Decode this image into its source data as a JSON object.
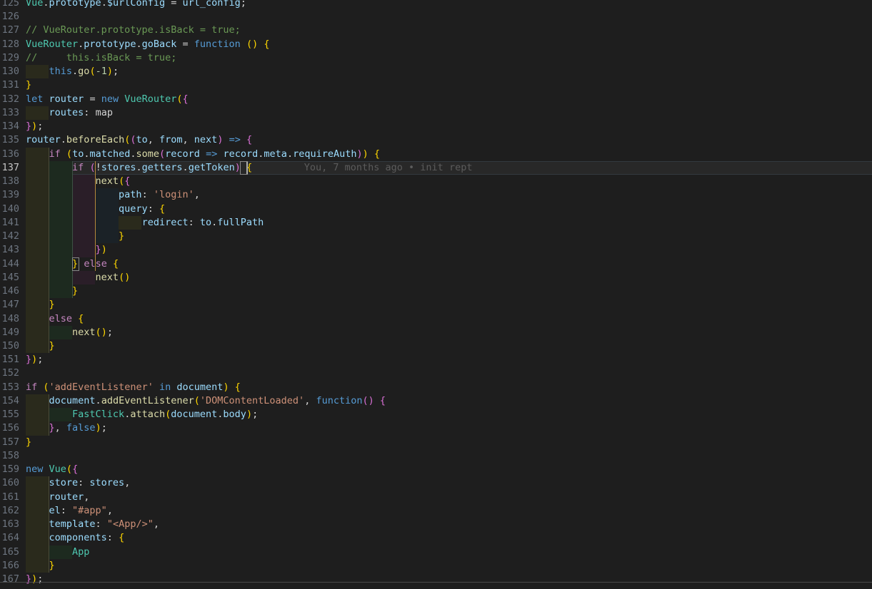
{
  "editor": {
    "name": "code-editor",
    "language": "javascript",
    "theme": "Dark+ (default dark)",
    "background": "#1e1e1e",
    "active_line_number": 137,
    "first_visible_line": 125,
    "last_visible_line": 167,
    "line_height_px": 19.24,
    "font_size_px": 13.5
  },
  "colors": {
    "background": "#1e1e1e",
    "foreground": "#d4d4d4",
    "line_number": "#6e7681",
    "line_number_active": "#c6c6c6",
    "active_line_bg": "#282828",
    "active_line_border": "#333a3f",
    "comment": "#6a9955",
    "keyword": "#c586c0",
    "keyword_blue": "#569cd6",
    "type": "#4ec9b0",
    "variable": "#9cdcfe",
    "function": "#dcdcaa",
    "string": "#ce9178",
    "number": "#b5cea8",
    "bracket_1": "#ffd700",
    "bracket_2": "#da70d6",
    "bracket_3": "#179fff",
    "indent_1": "#2a2a1c",
    "indent_2": "#1d2a1f",
    "indent_3": "#2a1e28",
    "indent_4": "#1b2227",
    "scope_line": "#b5893a",
    "blame_text": "#5c5c5c",
    "cursor": "#aeafad",
    "separator": "#4a4a4a"
  },
  "blame": {
    "name": "git-blame-annotation",
    "line": 137,
    "text": "You, 7 months ago • init rept",
    "author": "You",
    "when": "7 months ago",
    "message": "init rept"
  },
  "lines": [
    {
      "n": 125,
      "indent": 0,
      "tokens": [
        {
          "t": "Vue",
          "c": "c-type"
        },
        {
          "t": ".",
          "c": "c-op"
        },
        {
          "t": "prototype",
          "c": "c-var"
        },
        {
          "t": ".",
          "c": "c-op"
        },
        {
          "t": "$urlConfig",
          "c": "c-var"
        },
        {
          "t": " = ",
          "c": "c-op"
        },
        {
          "t": "url_config",
          "c": "c-var"
        },
        {
          "t": ";",
          "c": "c-op"
        }
      ]
    },
    {
      "n": 126,
      "indent": 0,
      "tokens": []
    },
    {
      "n": 127,
      "indent": 0,
      "tokens": [
        {
          "t": "// VueRouter.prototype.isBack = true;",
          "c": "c-com"
        }
      ]
    },
    {
      "n": 128,
      "indent": 0,
      "tokens": [
        {
          "t": "VueRouter",
          "c": "c-type"
        },
        {
          "t": ".",
          "c": "c-op"
        },
        {
          "t": "prototype",
          "c": "c-var"
        },
        {
          "t": ".",
          "c": "c-op"
        },
        {
          "t": "goBack",
          "c": "c-var"
        },
        {
          "t": " = ",
          "c": "c-op"
        },
        {
          "t": "function",
          "c": "c-kw2"
        },
        {
          "t": " ",
          "c": "c-op"
        },
        {
          "t": "(",
          "c": "c-p1"
        },
        {
          "t": ")",
          "c": "c-p1"
        },
        {
          "t": " ",
          "c": "c-op"
        },
        {
          "t": "{",
          "c": "c-p1"
        }
      ]
    },
    {
      "n": 129,
      "indent": 0,
      "tokens": [
        {
          "t": "//     this.isBack = true;",
          "c": "c-com"
        }
      ]
    },
    {
      "n": 130,
      "indent": 1,
      "tokens": [
        {
          "t": "this",
          "c": "c-kw2"
        },
        {
          "t": ".",
          "c": "c-op"
        },
        {
          "t": "go",
          "c": "c-fn"
        },
        {
          "t": "(",
          "c": "c-p1"
        },
        {
          "t": "-1",
          "c": "c-num"
        },
        {
          "t": ")",
          "c": "c-p1"
        },
        {
          "t": ";",
          "c": "c-op"
        }
      ]
    },
    {
      "n": 131,
      "indent": 0,
      "tokens": [
        {
          "t": "}",
          "c": "c-p1"
        }
      ]
    },
    {
      "n": 132,
      "indent": 0,
      "tokens": [
        {
          "t": "let",
          "c": "c-kw2"
        },
        {
          "t": " ",
          "c": "c-op"
        },
        {
          "t": "router",
          "c": "c-var"
        },
        {
          "t": " = ",
          "c": "c-op"
        },
        {
          "t": "new",
          "c": "c-kw2"
        },
        {
          "t": " ",
          "c": "c-op"
        },
        {
          "t": "VueRouter",
          "c": "c-type"
        },
        {
          "t": "(",
          "c": "c-p1"
        },
        {
          "t": "{",
          "c": "c-p2"
        }
      ]
    },
    {
      "n": 133,
      "indent": 1,
      "tokens": [
        {
          "t": "routes",
          "c": "c-var"
        },
        {
          "t": ": ",
          "c": "c-op"
        },
        {
          "t": "map",
          "c": "c-def"
        }
      ]
    },
    {
      "n": 134,
      "indent": 0,
      "tokens": [
        {
          "t": "}",
          "c": "c-p2"
        },
        {
          "t": ")",
          "c": "c-p1"
        },
        {
          "t": ";",
          "c": "c-op"
        }
      ]
    },
    {
      "n": 135,
      "indent": 0,
      "tokens": [
        {
          "t": "router",
          "c": "c-var"
        },
        {
          "t": ".",
          "c": "c-op"
        },
        {
          "t": "beforeEach",
          "c": "c-fn"
        },
        {
          "t": "(",
          "c": "c-p1"
        },
        {
          "t": "(",
          "c": "c-p2"
        },
        {
          "t": "to",
          "c": "c-var"
        },
        {
          "t": ", ",
          "c": "c-op"
        },
        {
          "t": "from",
          "c": "c-var"
        },
        {
          "t": ", ",
          "c": "c-op"
        },
        {
          "t": "next",
          "c": "c-var"
        },
        {
          "t": ")",
          "c": "c-p2"
        },
        {
          "t": " ",
          "c": "c-op"
        },
        {
          "t": "=>",
          "c": "c-kw2"
        },
        {
          "t": " ",
          "c": "c-op"
        },
        {
          "t": "{",
          "c": "c-p2"
        }
      ]
    },
    {
      "n": 136,
      "indent": 1,
      "tokens": [
        {
          "t": "if",
          "c": "c-kw"
        },
        {
          "t": " ",
          "c": "c-op"
        },
        {
          "t": "(",
          "c": "c-p1"
        },
        {
          "t": "to",
          "c": "c-var"
        },
        {
          "t": ".",
          "c": "c-op"
        },
        {
          "t": "matched",
          "c": "c-var"
        },
        {
          "t": ".",
          "c": "c-op"
        },
        {
          "t": "some",
          "c": "c-fn"
        },
        {
          "t": "(",
          "c": "c-p2"
        },
        {
          "t": "record",
          "c": "c-var"
        },
        {
          "t": " ",
          "c": "c-op"
        },
        {
          "t": "=>",
          "c": "c-kw2"
        },
        {
          "t": " ",
          "c": "c-op"
        },
        {
          "t": "record",
          "c": "c-var"
        },
        {
          "t": ".",
          "c": "c-op"
        },
        {
          "t": "meta",
          "c": "c-var"
        },
        {
          "t": ".",
          "c": "c-op"
        },
        {
          "t": "requireAuth",
          "c": "c-var"
        },
        {
          "t": ")",
          "c": "c-p2"
        },
        {
          "t": ")",
          "c": "c-p1"
        },
        {
          "t": " ",
          "c": "c-op"
        },
        {
          "t": "{",
          "c": "c-p1"
        }
      ]
    },
    {
      "n": 137,
      "indent": 2,
      "active": true,
      "tokens": [
        {
          "t": "if",
          "c": "c-kw"
        },
        {
          "t": " ",
          "c": "c-op"
        },
        {
          "t": "(",
          "c": "c-p2"
        },
        {
          "t": "!",
          "c": "c-op"
        },
        {
          "t": "stores",
          "c": "c-var"
        },
        {
          "t": ".",
          "c": "c-op"
        },
        {
          "t": "getters",
          "c": "c-var"
        },
        {
          "t": ".",
          "c": "c-op"
        },
        {
          "t": "getToken",
          "c": "c-var"
        },
        {
          "t": ")",
          "c": "c-p2"
        },
        {
          "t": " ",
          "c": "c-op"
        },
        {
          "t": "{",
          "c": "c-p1"
        }
      ]
    },
    {
      "n": 138,
      "indent": 3,
      "tokens": [
        {
          "t": "next",
          "c": "c-fn"
        },
        {
          "t": "(",
          "c": "c-p1"
        },
        {
          "t": "{",
          "c": "c-p2"
        }
      ]
    },
    {
      "n": 139,
      "indent": 4,
      "tokens": [
        {
          "t": "path",
          "c": "c-var"
        },
        {
          "t": ": ",
          "c": "c-op"
        },
        {
          "t": "'login'",
          "c": "c-str"
        },
        {
          "t": ",",
          "c": "c-op"
        }
      ]
    },
    {
      "n": 140,
      "indent": 4,
      "tokens": [
        {
          "t": "query",
          "c": "c-var"
        },
        {
          "t": ": ",
          "c": "c-op"
        },
        {
          "t": "{",
          "c": "c-p1"
        }
      ]
    },
    {
      "n": 141,
      "indent": 5,
      "tokens": [
        {
          "t": "redirect",
          "c": "c-var"
        },
        {
          "t": ": ",
          "c": "c-op"
        },
        {
          "t": "to",
          "c": "c-var"
        },
        {
          "t": ".",
          "c": "c-op"
        },
        {
          "t": "fullPath",
          "c": "c-var"
        }
      ]
    },
    {
      "n": 142,
      "indent": 4,
      "tokens": [
        {
          "t": "}",
          "c": "c-p1"
        }
      ]
    },
    {
      "n": 143,
      "indent": 3,
      "tokens": [
        {
          "t": "}",
          "c": "c-p2"
        },
        {
          "t": ")",
          "c": "c-p1"
        }
      ]
    },
    {
      "n": 144,
      "indent": 2,
      "tokens": [
        {
          "t": "}",
          "c": "c-p1"
        },
        {
          "t": " ",
          "c": "c-op"
        },
        {
          "t": "else",
          "c": "c-kw"
        },
        {
          "t": " ",
          "c": "c-op"
        },
        {
          "t": "{",
          "c": "c-p1"
        }
      ]
    },
    {
      "n": 145,
      "indent": 3,
      "tokens": [
        {
          "t": "next",
          "c": "c-fn"
        },
        {
          "t": "(",
          "c": "c-p1"
        },
        {
          "t": ")",
          "c": "c-p1"
        }
      ]
    },
    {
      "n": 146,
      "indent": 2,
      "tokens": [
        {
          "t": "}",
          "c": "c-p1"
        }
      ]
    },
    {
      "n": 147,
      "indent": 1,
      "tokens": [
        {
          "t": "}",
          "c": "c-p1"
        }
      ]
    },
    {
      "n": 148,
      "indent": 1,
      "tokens": [
        {
          "t": "else",
          "c": "c-kw"
        },
        {
          "t": " ",
          "c": "c-op"
        },
        {
          "t": "{",
          "c": "c-p1"
        }
      ]
    },
    {
      "n": 149,
      "indent": 2,
      "tokens": [
        {
          "t": "next",
          "c": "c-fn"
        },
        {
          "t": "(",
          "c": "c-p1"
        },
        {
          "t": ")",
          "c": "c-p1"
        },
        {
          "t": ";",
          "c": "c-op"
        }
      ]
    },
    {
      "n": 150,
      "indent": 1,
      "tokens": [
        {
          "t": "}",
          "c": "c-p1"
        }
      ]
    },
    {
      "n": 151,
      "indent": 0,
      "tokens": [
        {
          "t": "}",
          "c": "c-p2"
        },
        {
          "t": ")",
          "c": "c-p1"
        },
        {
          "t": ";",
          "c": "c-op"
        }
      ]
    },
    {
      "n": 152,
      "indent": 0,
      "tokens": []
    },
    {
      "n": 153,
      "indent": 0,
      "tokens": [
        {
          "t": "if",
          "c": "c-kw"
        },
        {
          "t": " ",
          "c": "c-op"
        },
        {
          "t": "(",
          "c": "c-p1"
        },
        {
          "t": "'addEventListener'",
          "c": "c-str"
        },
        {
          "t": " ",
          "c": "c-op"
        },
        {
          "t": "in",
          "c": "c-kw2"
        },
        {
          "t": " ",
          "c": "c-op"
        },
        {
          "t": "document",
          "c": "c-var"
        },
        {
          "t": ")",
          "c": "c-p1"
        },
        {
          "t": " ",
          "c": "c-op"
        },
        {
          "t": "{",
          "c": "c-p1"
        }
      ]
    },
    {
      "n": 154,
      "indent": 1,
      "tokens": [
        {
          "t": "document",
          "c": "c-var"
        },
        {
          "t": ".",
          "c": "c-op"
        },
        {
          "t": "addEventListener",
          "c": "c-fn"
        },
        {
          "t": "(",
          "c": "c-p1"
        },
        {
          "t": "'DOMContentLoaded'",
          "c": "c-str"
        },
        {
          "t": ", ",
          "c": "c-op"
        },
        {
          "t": "function",
          "c": "c-kw2"
        },
        {
          "t": "(",
          "c": "c-p2"
        },
        {
          "t": ")",
          "c": "c-p2"
        },
        {
          "t": " ",
          "c": "c-op"
        },
        {
          "t": "{",
          "c": "c-p2"
        }
      ]
    },
    {
      "n": 155,
      "indent": 2,
      "tokens": [
        {
          "t": "FastClick",
          "c": "c-type"
        },
        {
          "t": ".",
          "c": "c-op"
        },
        {
          "t": "attach",
          "c": "c-fn"
        },
        {
          "t": "(",
          "c": "c-p1"
        },
        {
          "t": "document",
          "c": "c-var"
        },
        {
          "t": ".",
          "c": "c-op"
        },
        {
          "t": "body",
          "c": "c-var"
        },
        {
          "t": ")",
          "c": "c-p1"
        },
        {
          "t": ";",
          "c": "c-op"
        }
      ]
    },
    {
      "n": 156,
      "indent": 1,
      "tokens": [
        {
          "t": "}",
          "c": "c-p2"
        },
        {
          "t": ", ",
          "c": "c-op"
        },
        {
          "t": "false",
          "c": "c-kw2"
        },
        {
          "t": ")",
          "c": "c-p1"
        },
        {
          "t": ";",
          "c": "c-op"
        }
      ]
    },
    {
      "n": 157,
      "indent": 0,
      "tokens": [
        {
          "t": "}",
          "c": "c-p1"
        }
      ]
    },
    {
      "n": 158,
      "indent": 0,
      "tokens": []
    },
    {
      "n": 159,
      "indent": 0,
      "tokens": [
        {
          "t": "new",
          "c": "c-kw2"
        },
        {
          "t": " ",
          "c": "c-op"
        },
        {
          "t": "Vue",
          "c": "c-type"
        },
        {
          "t": "(",
          "c": "c-p1"
        },
        {
          "t": "{",
          "c": "c-p2"
        }
      ]
    },
    {
      "n": 160,
      "indent": 1,
      "tokens": [
        {
          "t": "store",
          "c": "c-var"
        },
        {
          "t": ": ",
          "c": "c-op"
        },
        {
          "t": "stores",
          "c": "c-var"
        },
        {
          "t": ",",
          "c": "c-op"
        }
      ]
    },
    {
      "n": 161,
      "indent": 1,
      "tokens": [
        {
          "t": "router",
          "c": "c-var"
        },
        {
          "t": ",",
          "c": "c-op"
        }
      ]
    },
    {
      "n": 162,
      "indent": 1,
      "tokens": [
        {
          "t": "el",
          "c": "c-var"
        },
        {
          "t": ": ",
          "c": "c-op"
        },
        {
          "t": "\"#app\"",
          "c": "c-str"
        },
        {
          "t": ",",
          "c": "c-op"
        }
      ]
    },
    {
      "n": 163,
      "indent": 1,
      "tokens": [
        {
          "t": "template",
          "c": "c-var"
        },
        {
          "t": ": ",
          "c": "c-op"
        },
        {
          "t": "\"<App/>\"",
          "c": "c-str"
        },
        {
          "t": ",",
          "c": "c-op"
        }
      ]
    },
    {
      "n": 164,
      "indent": 1,
      "tokens": [
        {
          "t": "components",
          "c": "c-var"
        },
        {
          "t": ": ",
          "c": "c-op"
        },
        {
          "t": "{",
          "c": "c-p1"
        }
      ]
    },
    {
      "n": 165,
      "indent": 2,
      "tokens": [
        {
          "t": "App",
          "c": "c-type"
        }
      ]
    },
    {
      "n": 166,
      "indent": 1,
      "tokens": [
        {
          "t": "}",
          "c": "c-p1"
        }
      ]
    },
    {
      "n": 167,
      "indent": 0,
      "tokens": [
        {
          "t": "}",
          "c": "c-p2"
        },
        {
          "t": ")",
          "c": "c-p1"
        },
        {
          "t": ";",
          "c": "c-op"
        }
      ]
    }
  ]
}
